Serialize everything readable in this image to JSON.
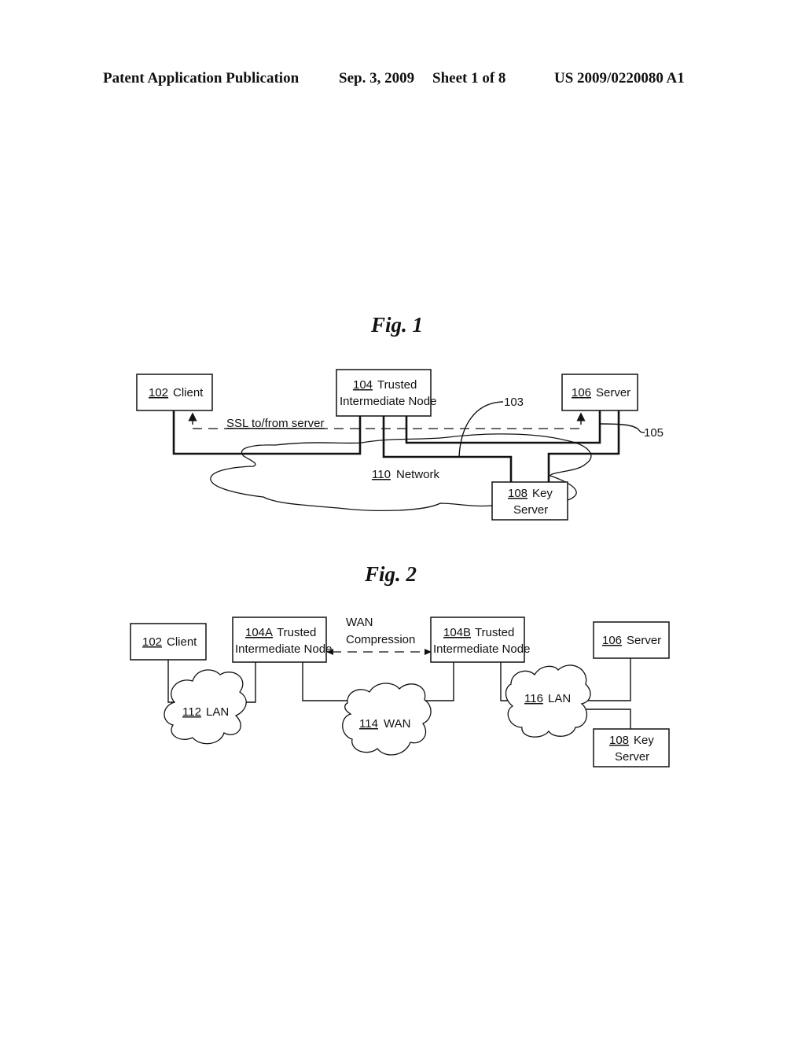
{
  "header": {
    "publication": "Patent Application Publication",
    "date": "Sep. 3, 2009",
    "sheet": "Sheet 1 of 8",
    "number": "US 2009/0220080 A1"
  },
  "fig1": {
    "title": "Fig. 1",
    "client": {
      "ref": "102",
      "label": "Client"
    },
    "tin": {
      "ref": "104",
      "label1": "Trusted",
      "label2": "Intermediate Node"
    },
    "server": {
      "ref": "106",
      "label": "Server"
    },
    "keyserver": {
      "ref": "108",
      "label1": "Key",
      "label2": "Server"
    },
    "network": {
      "ref": "110",
      "label": "Network"
    },
    "ssl_label": "SSL to/from server",
    "callout_103": "103",
    "callout_105": "105"
  },
  "fig2": {
    "title": "Fig. 2",
    "client": {
      "ref": "102",
      "label": "Client"
    },
    "tin_a": {
      "ref": "104A",
      "label1": "Trusted",
      "label2": "Intermediate Node"
    },
    "tin_b": {
      "ref": "104B",
      "label1": "Trusted",
      "label2": "Intermediate Node"
    },
    "server": {
      "ref": "106",
      "label": "Server"
    },
    "keyserver": {
      "ref": "108",
      "label1": "Key",
      "label2": "Server"
    },
    "lan1": {
      "ref": "112",
      "label": "LAN"
    },
    "wan": {
      "ref": "114",
      "label": "WAN"
    },
    "lan2": {
      "ref": "116",
      "label": "LAN"
    },
    "compression_label1": "WAN",
    "compression_label2": "Compression"
  }
}
